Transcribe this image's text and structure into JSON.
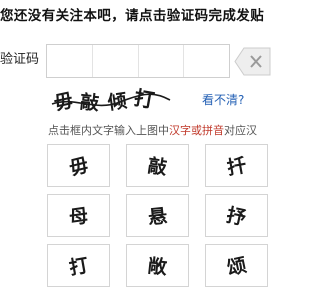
{
  "header": {
    "title": "您还没有关注本吧，请点击验证码完成发贴"
  },
  "form": {
    "label": "验证码"
  },
  "captcha": {
    "text": "毋敲倾打",
    "refresh_label": "看不清?"
  },
  "hint": {
    "prefix": "点击框内文字输入上图中",
    "highlight": "汉字或拼音",
    "suffix": "对应汉"
  },
  "tiles": [
    {
      "char": "毋"
    },
    {
      "char": "敲"
    },
    {
      "char": "扦"
    },
    {
      "char": "母"
    },
    {
      "char": "悬"
    },
    {
      "char": "抒"
    },
    {
      "char": "打"
    },
    {
      "char": "敞"
    },
    {
      "char": "颂"
    }
  ],
  "colors": {
    "link": "#2561b5",
    "highlight": "#c0392b"
  }
}
